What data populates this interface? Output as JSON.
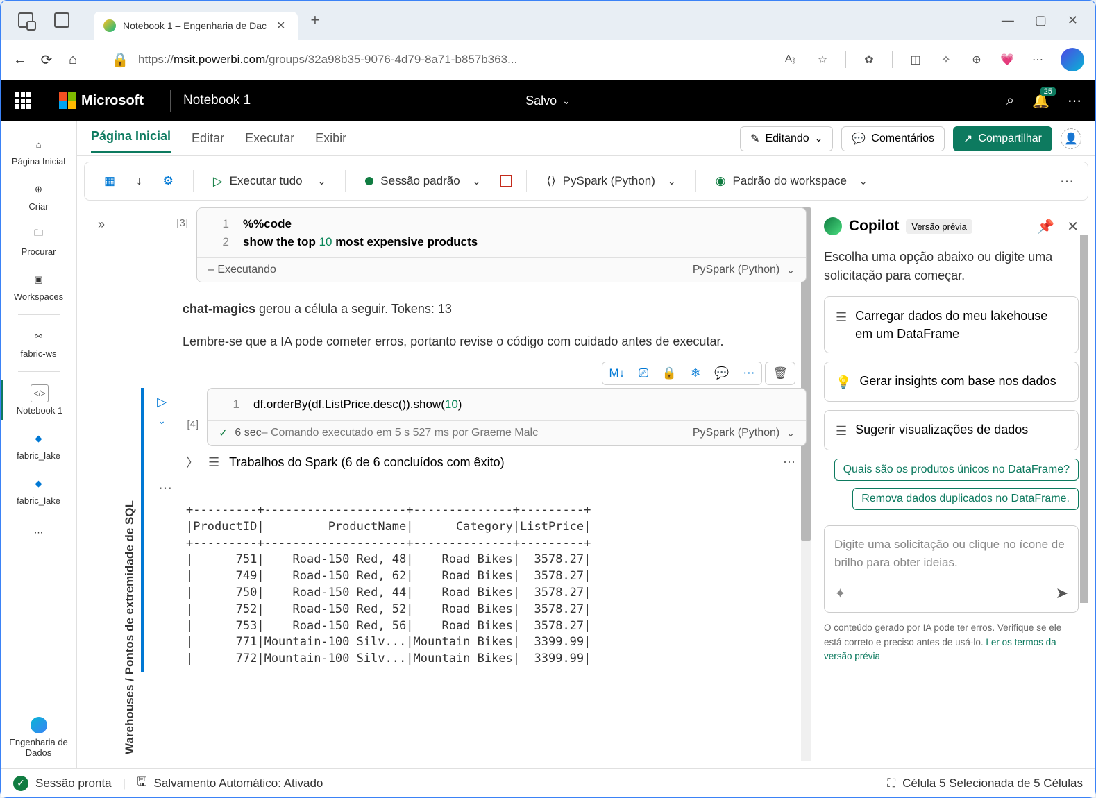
{
  "browser": {
    "tab_title": "Notebook 1 – Engenharia de Dac",
    "url_prefix": "https://",
    "url_domain": "msit.powerbi.com",
    "url_path": "/groups/32a98b35-9076-4d79-8a71-b857b363..."
  },
  "header": {
    "ms": "Microsoft",
    "notebook": "Notebook 1",
    "saved": "Salvo",
    "notif_count": "25"
  },
  "left_rail": {
    "home": "Página Inicial",
    "create": "Criar",
    "browse": "Procurar",
    "workspaces": "Workspaces",
    "fabric_ws": "fabric-ws",
    "notebook1": "Notebook 1",
    "lake1": "fabric_lake",
    "lake2": "fabric_lake",
    "eng": "Engenharia de Dados"
  },
  "menu": {
    "home": "Página Inicial",
    "edit": "Editar",
    "run": "Executar",
    "view": "Exibir",
    "editing": "Editando",
    "comments": "Comentários",
    "share": "Compartilhar"
  },
  "toolbar": {
    "run_all": "Executar tudo",
    "session": "Sessão padrão",
    "pyspark": "PySpark (Python)",
    "ws_default": "Padrão do workspace"
  },
  "vert_label": "Warehouses / Pontos de extremidade de SQL",
  "cell1": {
    "idx": "[3]",
    "l1": "%%code",
    "l2a": "show the top ",
    "l2n": "10",
    "l2b": " most expensive products",
    "running": "– Executando",
    "lang": "PySpark (Python)"
  },
  "msg": {
    "bold": "chat-magics",
    "rest": " gerou a célula a seguir. Tokens: 13",
    "warn": "Lembre-se que a IA pode cometer erros, portanto revise o código com cuidado antes de executar."
  },
  "cell2": {
    "idx": "[4]",
    "code_a": "df.orderBy(df.ListPrice.desc()).show(",
    "code_n": "10",
    "code_b": ")",
    "check_time": "6 sec",
    "check_msg": " – Comando executado em 5 s 527 ms por Graeme Malc",
    "lang": "PySpark (Python)",
    "toolbar_md": "M↓"
  },
  "spark": {
    "label": "Trabalhos do Spark (6 de 6 concluídos com êxito)"
  },
  "table": {
    "sep": "+---------+--------------------+--------------+---------+",
    "hdr": "|ProductID|         ProductName|      Category|ListPrice|",
    "rows": [
      "|      751|    Road-150 Red, 48|    Road Bikes|  3578.27|",
      "|      749|    Road-150 Red, 62|    Road Bikes|  3578.27|",
      "|      750|    Road-150 Red, 44|    Road Bikes|  3578.27|",
      "|      752|    Road-150 Red, 52|    Road Bikes|  3578.27|",
      "|      753|    Road-150 Red, 56|    Road Bikes|  3578.27|",
      "|      771|Mountain-100 Silv...|Mountain Bikes|  3399.99|",
      "|      772|Mountain-100 Silv...|Mountain Bikes|  3399.99|"
    ]
  },
  "copilot": {
    "title": "Copilot",
    "badge": "Versão prévia",
    "intro": "Escolha uma opção abaixo ou digite uma solicitação para começar.",
    "s1": "Carregar dados do meu lakehouse em um DataFrame",
    "s2": "Gerar insights com base nos dados",
    "s3": "Sugerir visualizações de dados",
    "chip1": "Quais são os produtos únicos no DataFrame?",
    "chip2": "Remova dados duplicados no DataFrame.",
    "placeholder": "Digite uma solicitação ou clique no ícone de brilho para obter ideias.",
    "foot1": "O conteúdo gerado por IA pode ter erros. Verifique se ele está correto e preciso antes de usá-lo. ",
    "foot_link": "Ler os termos da versão prévia"
  },
  "status": {
    "ready": "Sessão pronta",
    "autosave": "Salvamento Automático: Ativado",
    "cell_sel": "Célula 5 Selecionada de 5 Células"
  }
}
